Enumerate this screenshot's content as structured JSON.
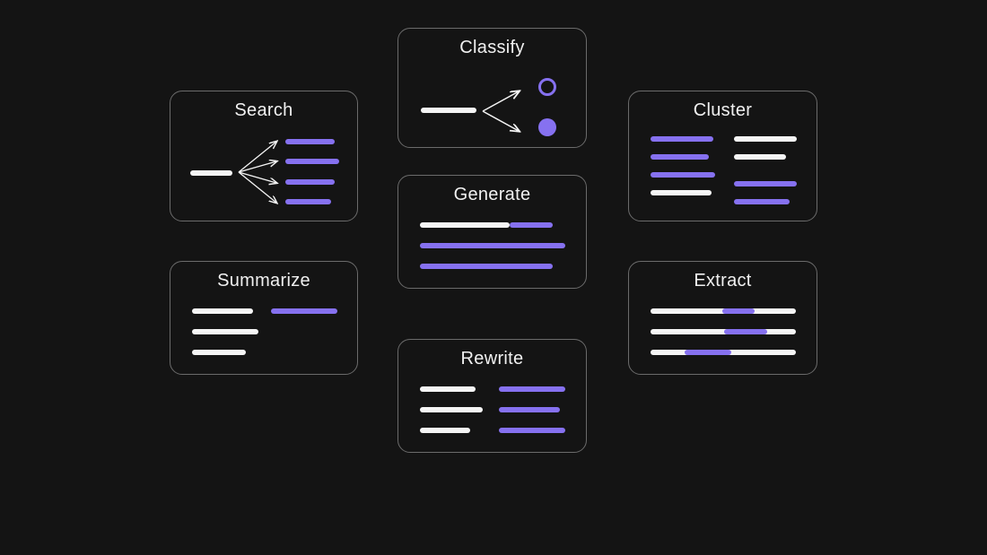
{
  "colors": {
    "accent": "#8671f0",
    "fg": "#f5f5f5",
    "border": "#6b6b6b",
    "bg": "#141414"
  },
  "cards": {
    "classify": {
      "title": "Classify"
    },
    "search": {
      "title": "Search"
    },
    "cluster": {
      "title": "Cluster"
    },
    "generate": {
      "title": "Generate"
    },
    "summarize": {
      "title": "Summarize"
    },
    "extract": {
      "title": "Extract"
    },
    "rewrite": {
      "title": "Rewrite"
    }
  }
}
